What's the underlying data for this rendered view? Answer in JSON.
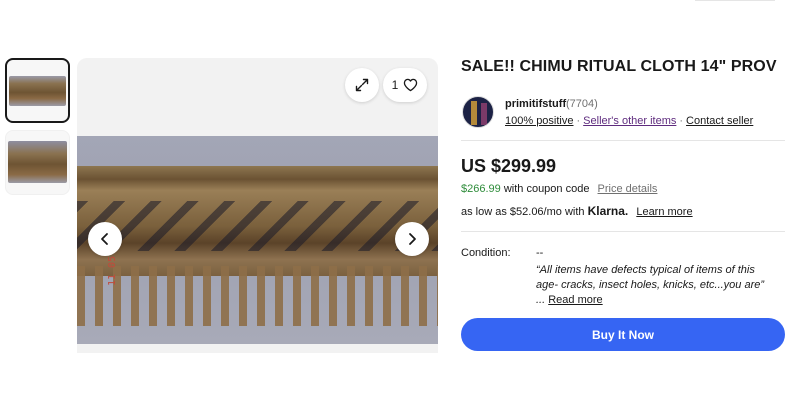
{
  "listing": {
    "title": "SALE!! CHIMU RITUAL CLOTH 14\" PROV",
    "watch_count": "1"
  },
  "gallery": {
    "thumbnails": [
      {
        "alt": "Chimu ritual cloth thumbnail 1",
        "selected": true
      },
      {
        "alt": "Chimu ritual cloth thumbnail 2",
        "selected": false
      }
    ],
    "photo_watermark": "11 05 2022",
    "icons": {
      "expand": "expand-icon",
      "watch": "heart-icon",
      "prev": "chevron-left-icon",
      "next": "chevron-right-icon"
    }
  },
  "seller": {
    "name": "primitifstuff",
    "feedback_count": "(7704)",
    "positive": "100% positive",
    "other_items": "Seller's other items",
    "contact": "Contact seller"
  },
  "pricing": {
    "price": "US $299.99",
    "coupon_price": "$266.99",
    "coupon_text": "with coupon code",
    "price_details": "Price details",
    "klarna_prefix": "as low as $52.06/mo with",
    "klarna_brand": "Klarna.",
    "learn_more": "Learn more"
  },
  "condition": {
    "label": "Condition:",
    "value": "--",
    "quote": "“All items have defects typical of items of this age- cracks, insect holes, knicks, etc...you are”",
    "read_more": "Read more"
  },
  "actions": {
    "buy_now": "Buy It Now"
  },
  "colors": {
    "buy_button": "#3665f3",
    "coupon_green": "#2e8c3a",
    "seller_link_purple": "#5e2b7e"
  }
}
